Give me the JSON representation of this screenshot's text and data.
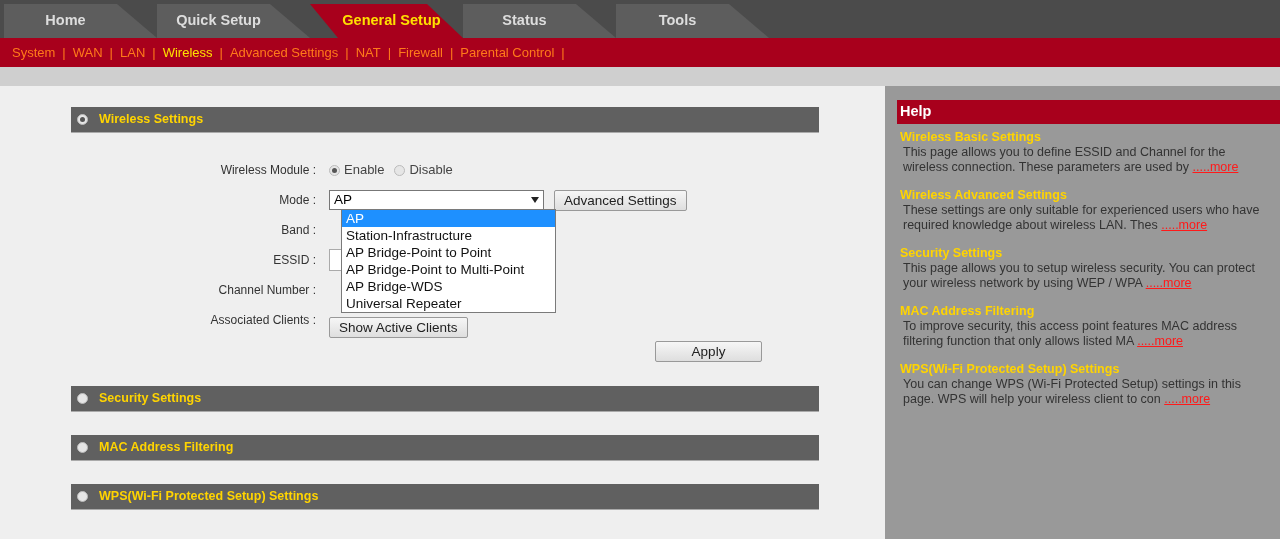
{
  "tabs": [
    {
      "label": "Home",
      "selected": false
    },
    {
      "label": "Quick Setup",
      "selected": false
    },
    {
      "label": "General Setup",
      "selected": true
    },
    {
      "label": "Status",
      "selected": false
    },
    {
      "label": "Tools",
      "selected": false
    }
  ],
  "subnav": [
    {
      "label": "System",
      "selected": false,
      "separator": "|"
    },
    {
      "label": "WAN",
      "selected": false,
      "separator": "|"
    },
    {
      "label": "LAN",
      "selected": false,
      "separator": "|"
    },
    {
      "label": "Wireless",
      "selected": true,
      "separator": "|"
    },
    {
      "label": "Advanced Settings",
      "selected": false,
      "separator": "|"
    },
    {
      "label": "NAT",
      "selected": false,
      "separator": "|"
    },
    {
      "label": "Firewall",
      "selected": false,
      "separator": "|"
    },
    {
      "label": "Parental Control",
      "selected": false,
      "separator": "|"
    }
  ],
  "sections": [
    {
      "title": "Wireless Settings",
      "expanded": true
    },
    {
      "title": "Security Settings",
      "expanded": false
    },
    {
      "title": "MAC Address Filtering",
      "expanded": false
    },
    {
      "title": "WPS(Wi-Fi Protected Setup) Settings",
      "expanded": false
    }
  ],
  "wireless_form": {
    "module": {
      "label": "Wireless Module :",
      "options": [
        {
          "label": "Enable",
          "selected": true
        },
        {
          "label": "Disable",
          "selected": false
        }
      ]
    },
    "mode": {
      "label": "Mode :",
      "value": "AP",
      "button": "Advanced Settings",
      "expanded": true,
      "options": [
        {
          "label": "AP",
          "selected": true
        },
        {
          "label": "Station-Infrastructure",
          "selected": false
        },
        {
          "label": "AP Bridge-Point to Point",
          "selected": false
        },
        {
          "label": "AP Bridge-Point to Multi-Point",
          "selected": false
        },
        {
          "label": "AP Bridge-WDS",
          "selected": false
        },
        {
          "label": "Universal Repeater",
          "selected": false
        }
      ]
    },
    "band": {
      "label": "Band :"
    },
    "essid": {
      "label": "ESSID :"
    },
    "channel": {
      "label": "Channel Number :"
    },
    "clients": {
      "label": "Associated Clients :",
      "button": "Show Active Clients"
    },
    "apply": "Apply"
  },
  "help": {
    "title": "Help",
    "items": [
      {
        "title": "Wireless Basic Settings",
        "text": "This page allows you to define ESSID and Channel for the wireless connection. These parameters are used by ",
        "more": ".....more"
      },
      {
        "title": "Wireless Advanced Settings",
        "text": "These settings are only suitable for experienced users who have required knowledge about wireless LAN. Thes ",
        "more": ".....more"
      },
      {
        "title": "Security Settings",
        "text": "This page allows you to setup wireless security. You can protect your wireless network by using WEP / WPA ",
        "more": ".....more"
      },
      {
        "title": "MAC Address Filtering",
        "text": "To improve security, this access point features MAC address filtering function that only allows listed MA ",
        "more": ".....more"
      },
      {
        "title": "WPS(Wi-Fi Protected Setup) Settings",
        "text": "You can change WPS (Wi-Fi Protected Setup) settings in this page. WPS will help your wireless client to con ",
        "more": ".....more"
      }
    ]
  }
}
